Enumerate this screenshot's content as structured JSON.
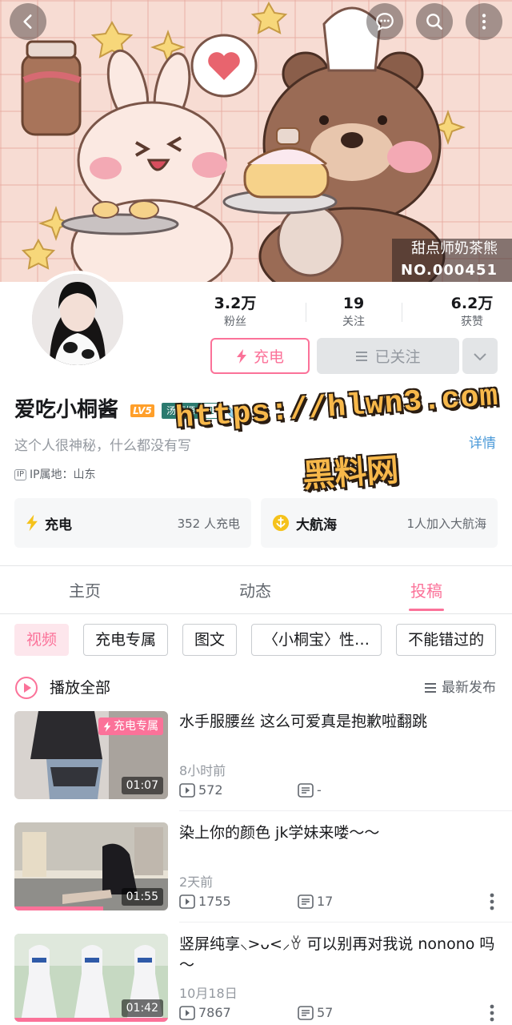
{
  "banner": {
    "caption_title": "甜点师奶茶熊",
    "caption_no": "NO.000451"
  },
  "profile": {
    "name": "爱吃小桐酱",
    "level": "LV5",
    "fan_badge_name": "汤塬塬",
    "fan_badge_level": "21",
    "signature": "这个人很神秘，什么都没有写",
    "detail_link": "详情",
    "ip_tag": "IP",
    "ip_location": "IP属地：山东"
  },
  "stats": [
    {
      "value": "3.2万",
      "label": "粉丝"
    },
    {
      "value": "19",
      "label": "关注"
    },
    {
      "value": "6.2万",
      "label": "获赞"
    }
  ],
  "actions": {
    "charge": "充电",
    "followed": "已关注"
  },
  "watermark": {
    "url": "https://hlwn3.com",
    "name": "黑料网"
  },
  "cards": {
    "charge": {
      "title": "充电",
      "desc": "352 人充电"
    },
    "fleet": {
      "title": "大航海",
      "desc": "1人加入大航海"
    }
  },
  "tabs": [
    {
      "label": "主页",
      "active": false
    },
    {
      "label": "动态",
      "active": false
    },
    {
      "label": "投稿",
      "active": true
    }
  ],
  "chips": [
    "视频",
    "充电专属",
    "图文",
    "〈小桐宝〉性…",
    "不能错过的"
  ],
  "play_all": "播放全部",
  "sort": "最新发布",
  "videos": [
    {
      "title": "水手服腰丝 这么可爱真是抱歉啦翻跳",
      "time": "8小时前",
      "plays": "572",
      "comments": "-",
      "duration": "01:07",
      "badge": "充电专属",
      "progress": 0
    },
    {
      "title": "染上你的颜色 jk学妹来喽～～",
      "time": "2天前",
      "plays": "1755",
      "comments": "17",
      "duration": "01:55",
      "badge": "",
      "progress": 0.58
    },
    {
      "title": "竖屏纯享⸜>ᴗ<⸝ꈊ 可以别再对我说 nonono 吗～",
      "time": "10月18日",
      "plays": "7867",
      "comments": "57",
      "duration": "01:42",
      "badge": "",
      "progress": 1.0
    }
  ],
  "colors": {
    "accent": "#fb7299",
    "link": "#4d9bd9",
    "watermark": "#f7b84a"
  }
}
